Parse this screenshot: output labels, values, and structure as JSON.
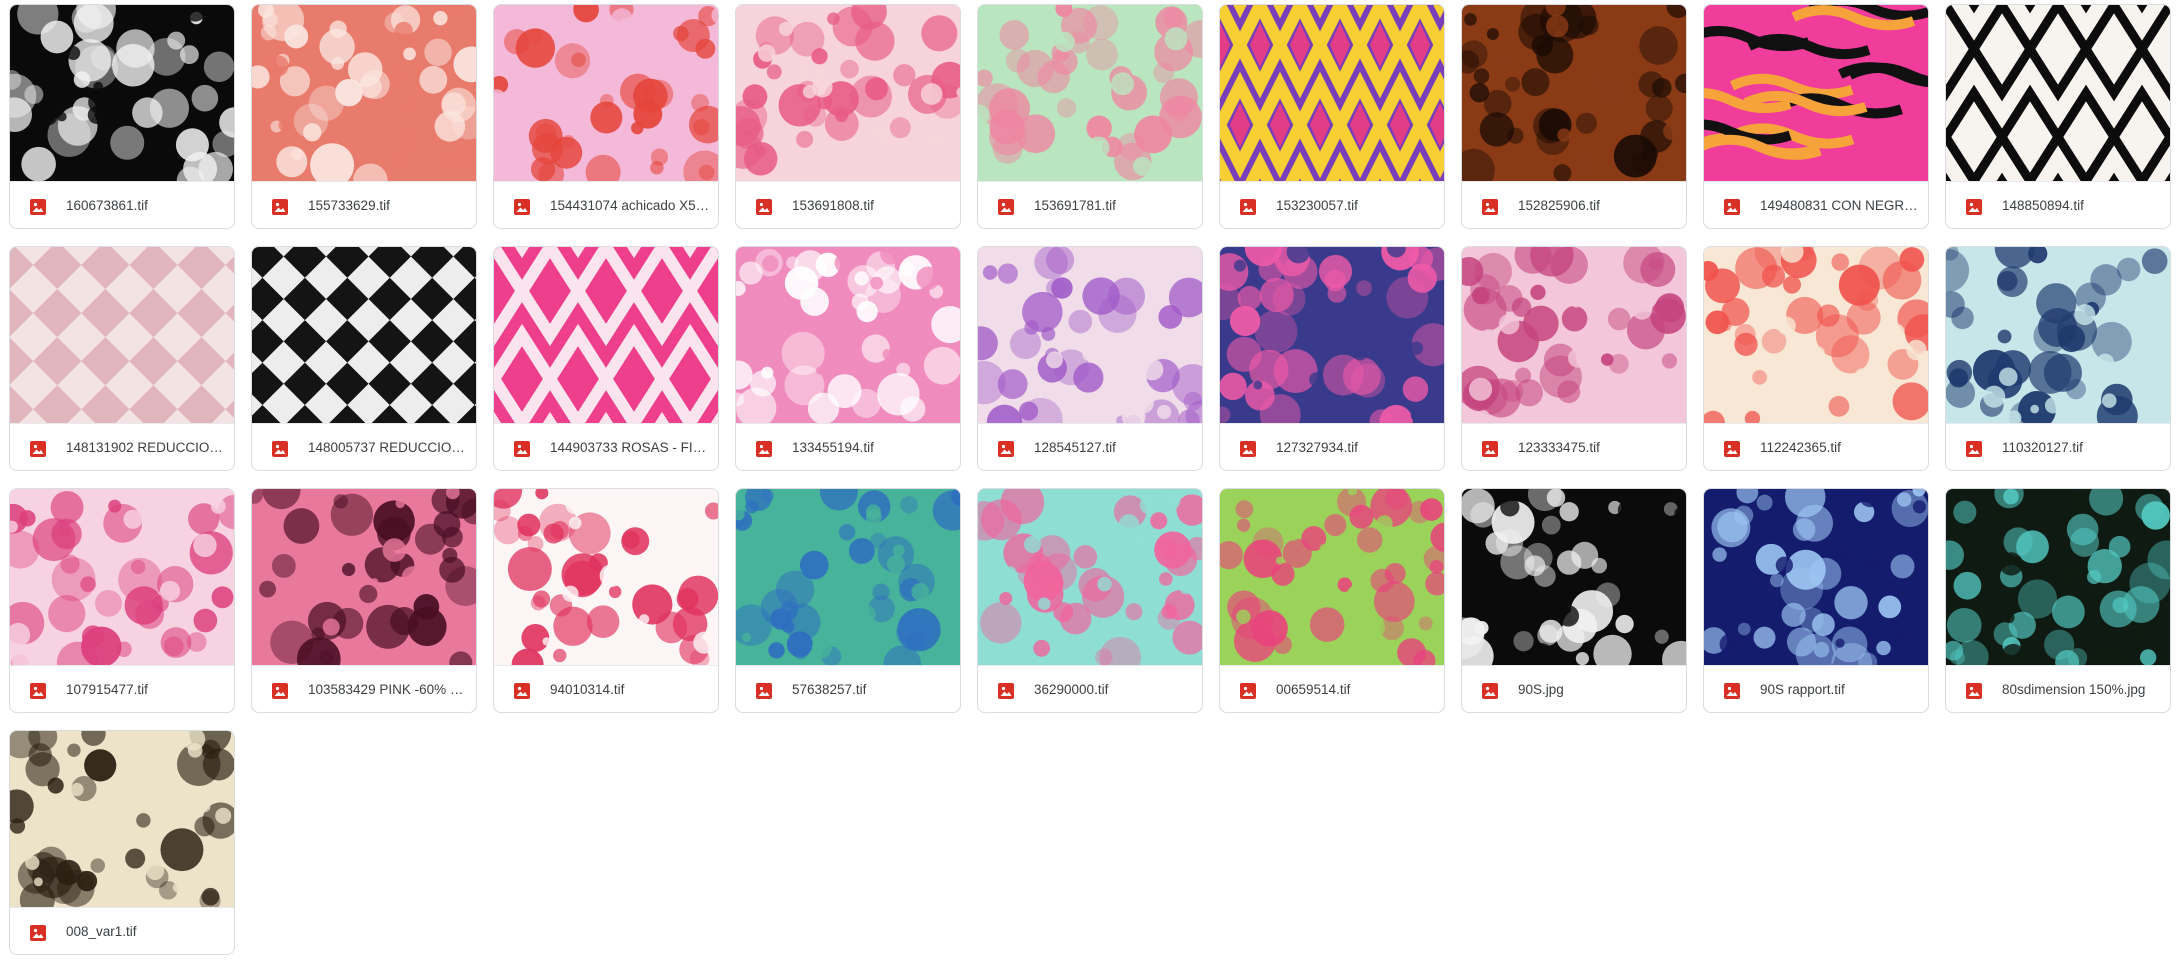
{
  "files": [
    {
      "name": "160673861.tif",
      "thumb": "skulls",
      "bg": "#0a0a0a",
      "fg": "#f2f2f2",
      "icon": "image-file-icon"
    },
    {
      "name": "155733629.tif",
      "thumb": "hibiscus",
      "bg": "#e87b6c",
      "fg": "#fbe6e0",
      "icon": "image-file-icon"
    },
    {
      "name": "154431074 achicado X5 ...",
      "thumb": "feathers",
      "bg": "#f4b9d8",
      "fg": "#e5453b",
      "icon": "image-file-icon"
    },
    {
      "name": "153691808.tif",
      "thumb": "roses",
      "bg": "#f7d4db",
      "fg": "#e85c86",
      "icon": "image-file-icon"
    },
    {
      "name": "153691781.tif",
      "thumb": "roses",
      "bg": "#b9e6bf",
      "fg": "#ef86a2",
      "icon": "image-file-icon"
    },
    {
      "name": "153230057.tif",
      "thumb": "ikat",
      "bg": "#7a3fb8",
      "fg": "#f6d033",
      "icon": "image-file-icon"
    },
    {
      "name": "152825906.tif",
      "thumb": "leopard",
      "bg": "#8a3b16",
      "fg": "#1b0b04",
      "icon": "image-file-icon"
    },
    {
      "name": "149480831 CON NEGRO....",
      "thumb": "tiger",
      "bg": "#f03c9b",
      "fg": "#f6a33c",
      "icon": "image-file-icon"
    },
    {
      "name": "148850894.tif",
      "thumb": "diamond",
      "bg": "#f7f3ef",
      "fg": "#0c0c0c",
      "icon": "image-file-icon"
    },
    {
      "name": "148131902 REDUCCION ...",
      "thumb": "plaid",
      "bg": "#f3e3e3",
      "fg": "#d9a6ad",
      "icon": "image-file-icon"
    },
    {
      "name": "148005737 REDUCCION ...",
      "thumb": "checker",
      "bg": "#ededed",
      "fg": "#141414",
      "icon": "image-file-icon"
    },
    {
      "name": "144903733 ROSAS - FIN...",
      "thumb": "ikat2",
      "bg": "#ee3f8d",
      "fg": "#fbe4ee",
      "icon": "image-file-icon"
    },
    {
      "name": "133455194.tif",
      "thumb": "girlyskull",
      "bg": "#f08bbd",
      "fg": "#ffffff",
      "icon": "image-file-icon"
    },
    {
      "name": "128545127.tif",
      "thumb": "blossom",
      "bg": "#f1dde9",
      "fg": "#a05ac8",
      "icon": "image-file-icon"
    },
    {
      "name": "127327934.tif",
      "thumb": "abstract",
      "bg": "#3a3a8c",
      "fg": "#ee5aa8",
      "icon": "image-file-icon"
    },
    {
      "name": "123333475.tif",
      "thumb": "animalpink",
      "bg": "#f3c6d9",
      "fg": "#c5447e",
      "icon": "image-file-icon"
    },
    {
      "name": "112242365.tif",
      "thumb": "poppies",
      "bg": "#f8e7d4",
      "fg": "#f0524d",
      "icon": "image-file-icon"
    },
    {
      "name": "110320127.tif",
      "thumb": "nautical",
      "bg": "#c7e6ea",
      "fg": "#1f3a6e",
      "icon": "image-file-icon"
    },
    {
      "name": "107915477.tif",
      "thumb": "paisley",
      "bg": "#f7d2e1",
      "fg": "#dc3f7d",
      "icon": "image-file-icon"
    },
    {
      "name": "103583429 PINK -60% E...",
      "thumb": "leopardpink",
      "bg": "#e8789c",
      "fg": "#4a0f24",
      "icon": "image-file-icon"
    },
    {
      "name": "94010314.tif",
      "thumb": "lips",
      "bg": "#fdf5f6",
      "fg": "#e0335e",
      "icon": "image-file-icon"
    },
    {
      "name": "57638257.tif",
      "thumb": "snake",
      "bg": "#47b39a",
      "fg": "#2f6fbf",
      "icon": "image-file-icon"
    },
    {
      "name": "36290000.tif",
      "thumb": "hearts",
      "bg": "#8fded4",
      "fg": "#f0659d",
      "icon": "image-file-icon"
    },
    {
      "name": "00659514.tif",
      "thumb": "mandala",
      "bg": "#9bd35a",
      "fg": "#e8447c",
      "icon": "image-file-icon"
    },
    {
      "name": "90S.jpg",
      "thumb": "memphis",
      "bg": "#0b0b0b",
      "fg": "#f2f2f2",
      "icon": "image-file-icon"
    },
    {
      "name": "90S rapport.tif",
      "thumb": "retro",
      "bg": "#141c6e",
      "fg": "#9fc8f5",
      "icon": "image-file-icon"
    },
    {
      "name": "80sdimension 150%.jpg",
      "thumb": "eighties",
      "bg": "#0f1a12",
      "fg": "#52c7c0",
      "icon": "image-file-icon"
    },
    {
      "name": "008_var1.tif",
      "thumb": "furleopard",
      "bg": "#ece3c9",
      "fg": "#2a1f12",
      "icon": "image-file-icon"
    }
  ]
}
